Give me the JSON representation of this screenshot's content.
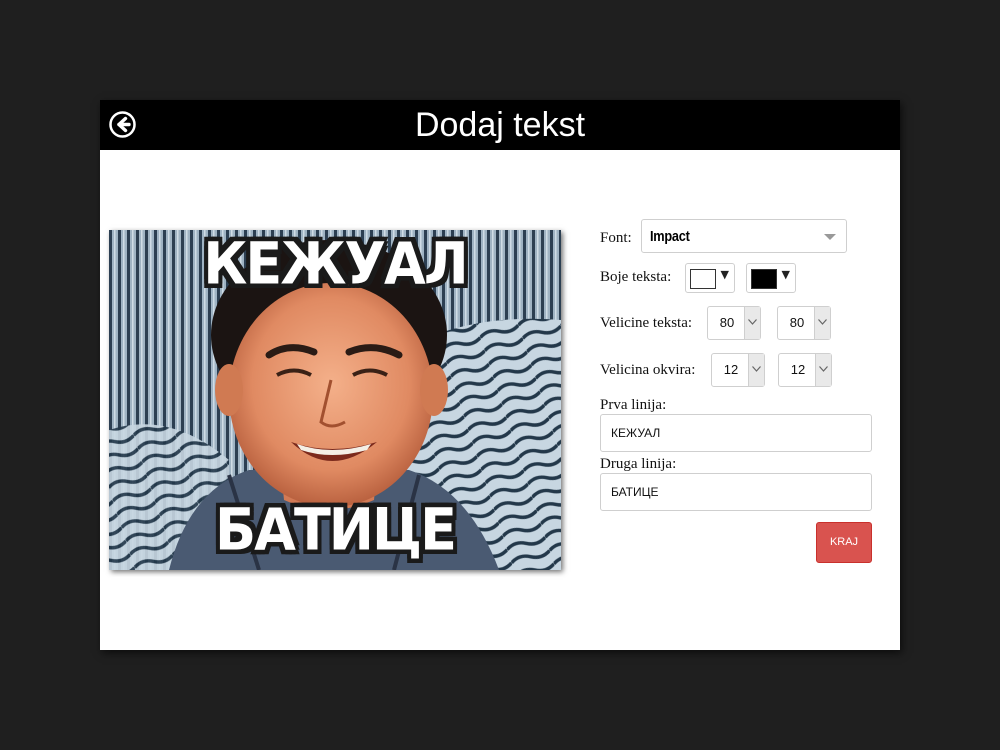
{
  "dialog": {
    "title": "Dodaj tekst",
    "back_icon": "arrow-left-circle-icon"
  },
  "meme": {
    "top_text": "КЕЖУАЛ",
    "bottom_text": "БАТИЦЕ"
  },
  "form": {
    "font_label": "Font:",
    "font_value": "Impact",
    "text_colors_label": "Boje teksta:",
    "text_color_1": "#ffffff",
    "text_color_2": "#000000",
    "text_size_label": "Velicine teksta:",
    "text_size_1": "80",
    "text_size_2": "80",
    "border_size_label": "Velicina okvira:",
    "border_size_1": "12",
    "border_size_2": "12",
    "first_line_label": "Prva linija:",
    "first_line_value": "КЕЖУАЛ",
    "second_line_label": "Druga linija:",
    "second_line_value": "БАТИЦЕ",
    "finish_button": "KRAJ"
  },
  "colors": {
    "header_bg": "#000000",
    "finish_button": "#d9534f",
    "page_bg": "#1f1f1f"
  }
}
